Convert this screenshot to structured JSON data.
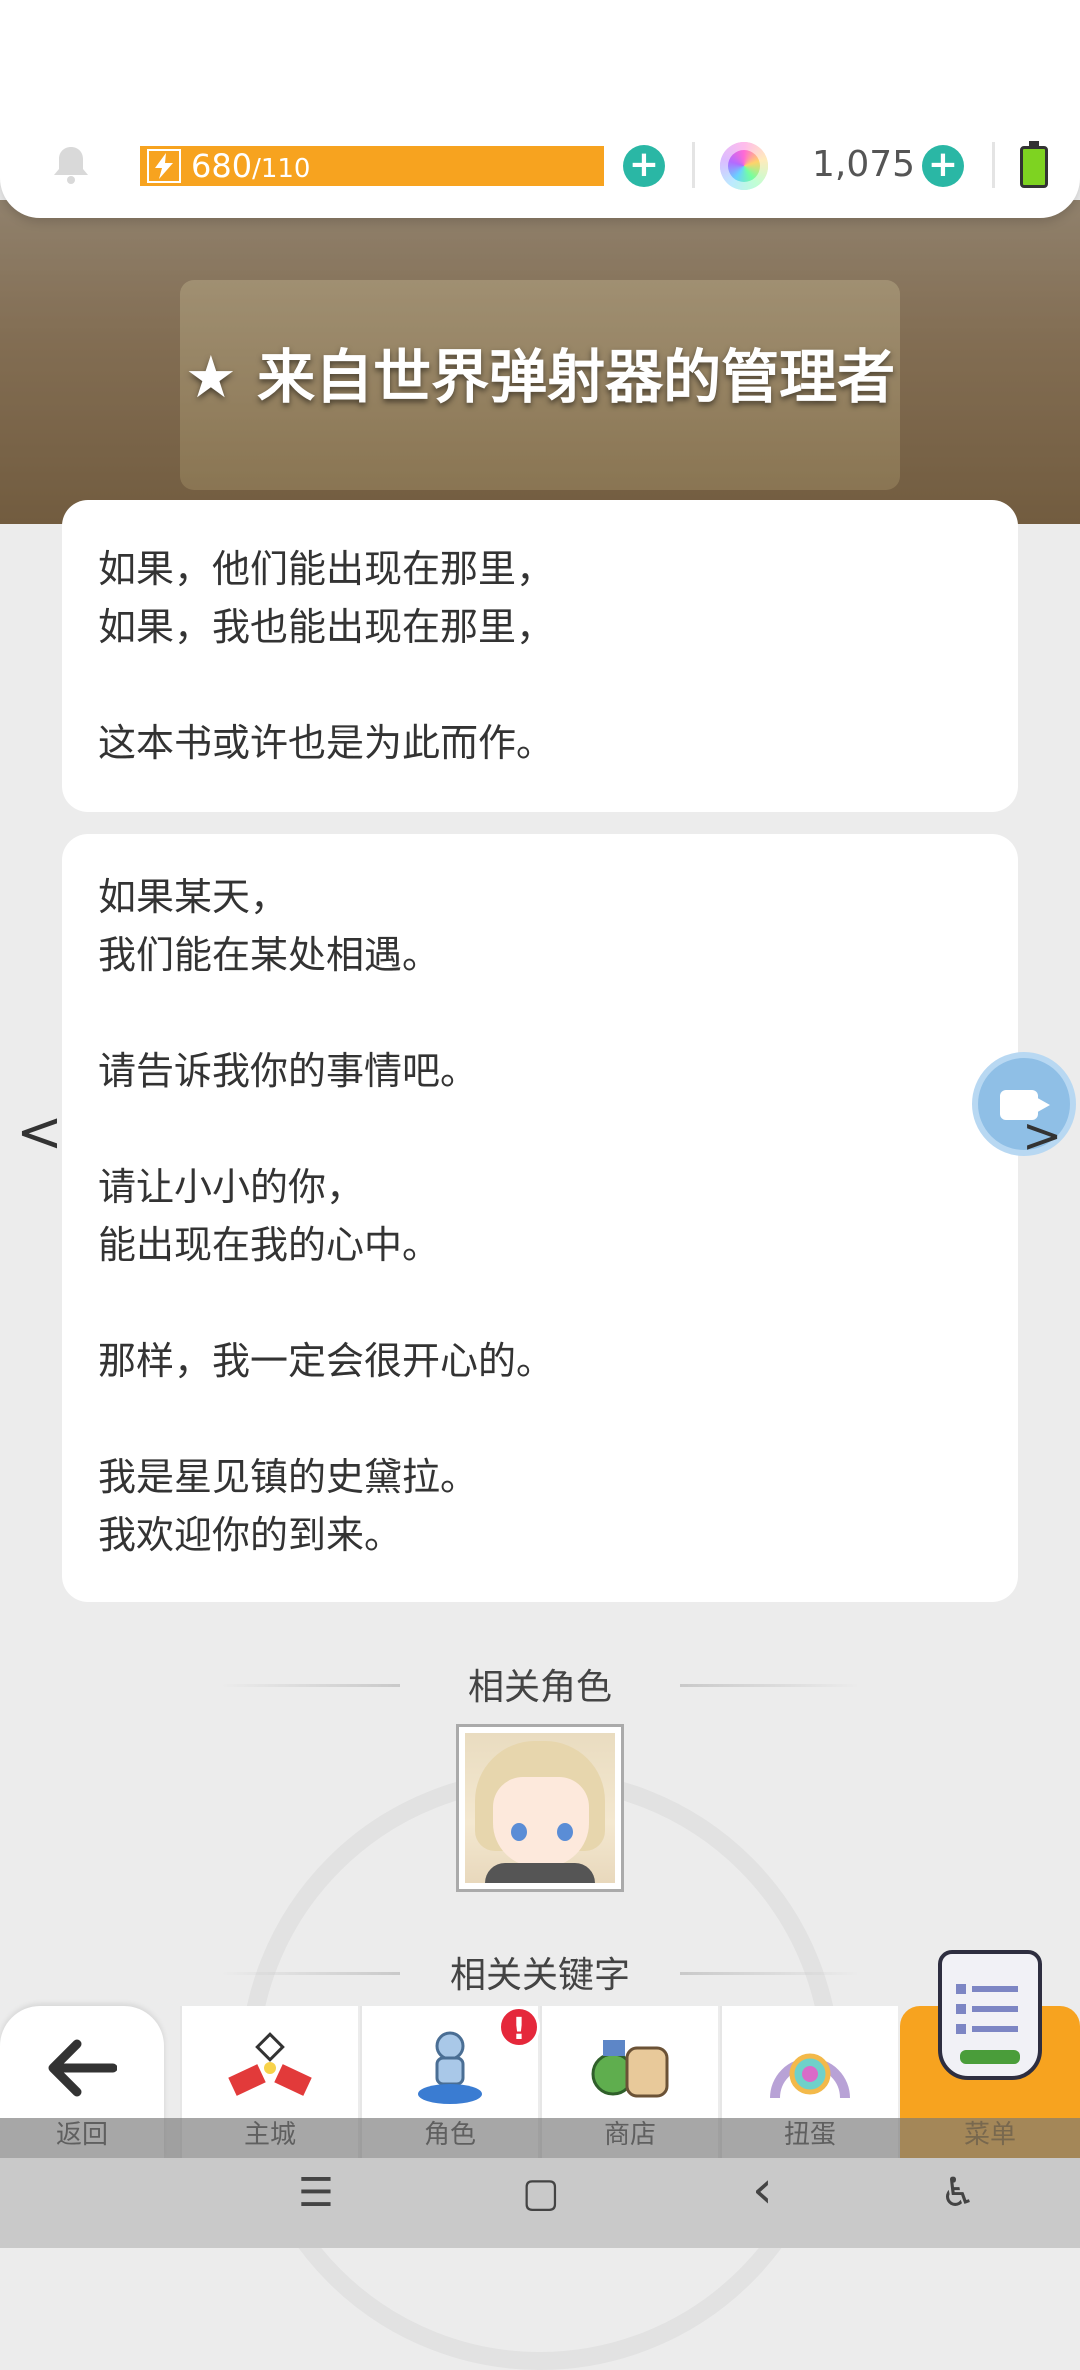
{
  "status": {
    "stamina_current": "680",
    "stamina_max": "/110",
    "gems": "1,075",
    "accent": "#f7a31f",
    "plus_color": "#2ab7a5"
  },
  "banner": {
    "title": "★ 来自世界弹射器的管理者"
  },
  "card1": {
    "lines": [
      "如果，他们能出现在那里，",
      "如果，我也能出现在那里，",
      "",
      "这本书或许也是为此而作。"
    ]
  },
  "card2": {
    "lines": [
      "如果某天，",
      "我们能在某处相遇。",
      "",
      "请告诉我你的事情吧。",
      "",
      "请让小小的你，",
      "能出现在我的心中。",
      "",
      "那样，我一定会很开心的。",
      "",
      "我是星见镇的史黛拉。",
      "我欢迎你的到来。"
    ]
  },
  "nav": {
    "prev": "<",
    "next": ">"
  },
  "sections": {
    "related_characters": "相关角色",
    "related_keywords": "相关关键字"
  },
  "tabs": {
    "back": "返回",
    "home": "主城",
    "character": "角色",
    "shop": "商店",
    "gacha": "扭蛋",
    "menu": "菜单",
    "badge": "!"
  },
  "system_nav": {
    "menu": "☰",
    "home": "▢",
    "back": "‹",
    "accessibility": "♿"
  }
}
